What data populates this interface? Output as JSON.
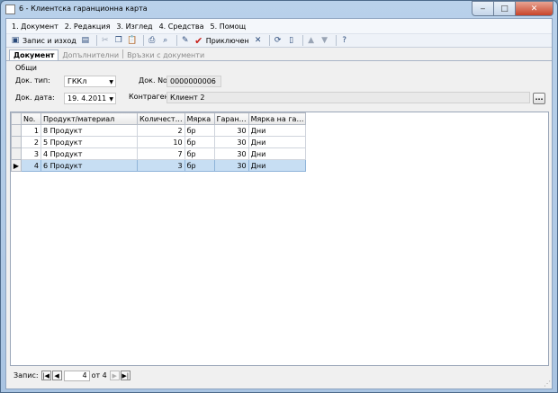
{
  "window": {
    "title": "6 - Клиентска гаранционна карта",
    "minimize_glyph": "‒",
    "maximize_glyph": "□",
    "close_glyph": "✕"
  },
  "menu": [
    {
      "label": "1. Документ"
    },
    {
      "label": "2. Редакция"
    },
    {
      "label": "3. Изглед"
    },
    {
      "label": "4. Средства"
    },
    {
      "label": "5. Помощ"
    }
  ],
  "toolbar": {
    "save_exit_label": "Запис и изход",
    "status_label": "Приключен",
    "icons": {
      "save": "▣",
      "new_page": "▤",
      "cut": "✂",
      "copy": "❐",
      "paste": "📋",
      "print": "⎙",
      "preview": "⌕",
      "edit": "✎",
      "check": "✔",
      "cancel": "✕",
      "refresh": "⟳",
      "blank": "▯",
      "up": "▲",
      "down": "▼",
      "help": "?"
    }
  },
  "tabs": [
    {
      "label": "Документ"
    },
    {
      "label": "Допълнителни"
    },
    {
      "label": "Връзки с документи"
    }
  ],
  "form": {
    "group_label": "Общи",
    "doc_type_label": "Док. тип:",
    "doc_type_value": "ГККл",
    "doc_no_label": "Док. No.",
    "doc_no_value": "0000000006",
    "doc_date_label": "Док. дата:",
    "doc_date_value": "19.  4.2011",
    "counterparty_label": "Контрагент:",
    "counterparty_value": "Клиент 2",
    "ellipsis": "..."
  },
  "grid": {
    "columns": [
      "No.",
      "Продукт/материал",
      "Количест…",
      "Мярка",
      "Гаран…",
      "Мярка на га…"
    ],
    "rows": [
      {
        "no": "1",
        "product": "8 Продукт",
        "qty": "2",
        "unit": "бр",
        "warranty": "30",
        "warranty_unit": "Дни"
      },
      {
        "no": "2",
        "product": "5 Продукт",
        "qty": "10",
        "unit": "бр",
        "warranty": "30",
        "warranty_unit": "Дни"
      },
      {
        "no": "3",
        "product": "4 Продукт",
        "qty": "7",
        "unit": "бр",
        "warranty": "30",
        "warranty_unit": "Дни"
      },
      {
        "no": "4",
        "product": "6 Продукт",
        "qty": "3",
        "unit": "бр",
        "warranty": "30",
        "warranty_unit": "Дни"
      }
    ],
    "selected_row_marker": "▶"
  },
  "navigator": {
    "label": "Запис:",
    "current": "4",
    "total_text": "от 4",
    "first_glyph": "|◀",
    "prev_glyph": "◀",
    "next_glyph": "▶",
    "last_glyph": "▶|"
  }
}
